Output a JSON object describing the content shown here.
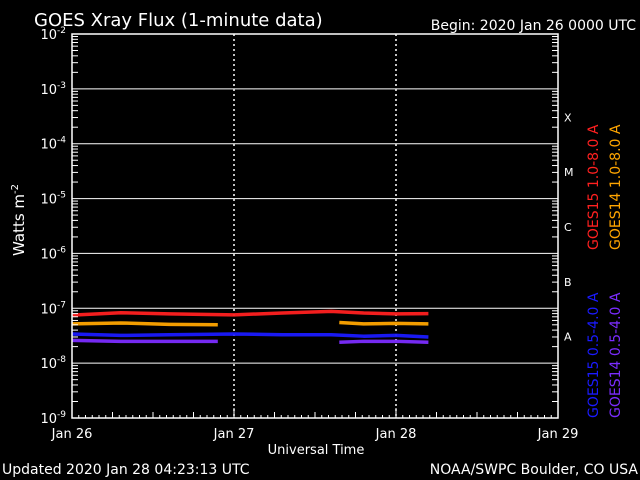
{
  "title": "GOES Xray Flux (1-minute data)",
  "begin": "Begin:  2020 Jan 26 0000 UTC",
  "updated": "Updated 2020 Jan 28 04:23:13 UTC",
  "credit": "NOAA/SWPC Boulder, CO USA",
  "colors": {
    "background": "#000000",
    "axes": "#ffffff",
    "goes15_long": "#ff2020",
    "goes14_long": "#ffa500",
    "goes15_short": "#1a1aff",
    "goes14_short": "#7b2cff"
  },
  "chart_data": {
    "type": "line",
    "title": "GOES Xray Flux (1-minute data)",
    "xlabel": "Universal Time",
    "ylabel": "Watts m-2",
    "yscale": "log",
    "ylim": [
      1e-09,
      0.01
    ],
    "xlim_days": [
      0,
      3
    ],
    "x_ticks": [
      "Jan 26",
      "Jan 27",
      "Jan 28",
      "Jan 29"
    ],
    "y_ticks": [
      {
        "base": "10",
        "exp": "-9",
        "value": 1e-09
      },
      {
        "base": "10",
        "exp": "-8",
        "value": 1e-08
      },
      {
        "base": "10",
        "exp": "-7",
        "value": 1e-07
      },
      {
        "base": "10",
        "exp": "-6",
        "value": 1e-06
      },
      {
        "base": "10",
        "exp": "-5",
        "value": 1e-05
      },
      {
        "base": "10",
        "exp": "-4",
        "value": 0.0001
      },
      {
        "base": "10",
        "exp": "-3",
        "value": 0.001
      },
      {
        "base": "10",
        "exp": "-2",
        "value": 0.01
      }
    ],
    "flare_classes": [
      {
        "label": "A",
        "value": 3.162e-08
      },
      {
        "label": "B",
        "value": 3.162e-07
      },
      {
        "label": "C",
        "value": 3.162e-06
      },
      {
        "label": "M",
        "value": 3.162e-05
      },
      {
        "label": "X",
        "value": 0.0003162
      }
    ],
    "grid": true,
    "series": [
      {
        "name": "GOES15 1.0-8.0 A",
        "color": "#ff2020",
        "x": [
          0.0,
          0.3,
          0.6,
          1.0,
          1.3,
          1.6,
          1.8,
          2.0,
          2.2
        ],
        "y": [
          7.5e-08,
          8.3e-08,
          7.9e-08,
          7.6e-08,
          8.2e-08,
          8.8e-08,
          8.2e-08,
          7.9e-08,
          8e-08
        ]
      },
      {
        "name": "GOES14 1.0-8.0 A",
        "color": "#ffa500",
        "segments": [
          {
            "x": [
              0.0,
              0.3,
              0.6,
              0.9
            ],
            "y": [
              5.2e-08,
              5.4e-08,
              5.1e-08,
              5e-08
            ]
          },
          {
            "x": [
              1.65,
              1.8,
              2.0,
              2.2
            ],
            "y": [
              5.5e-08,
              5.2e-08,
              5.3e-08,
              5.2e-08
            ]
          }
        ]
      },
      {
        "name": "GOES15 0.5-4.0 A",
        "color": "#1a1aff",
        "x": [
          0.0,
          0.3,
          0.6,
          1.0,
          1.3,
          1.6,
          1.8,
          2.0,
          2.2
        ],
        "y": [
          3.4e-08,
          3.2e-08,
          3.3e-08,
          3.4e-08,
          3.3e-08,
          3.3e-08,
          3.1e-08,
          3.2e-08,
          3e-08
        ]
      },
      {
        "name": "GOES14 0.5-4.0 A",
        "color": "#7b2cff",
        "segments": [
          {
            "x": [
              0.0,
              0.3,
              0.6,
              0.9
            ],
            "y": [
              2.6e-08,
              2.5e-08,
              2.5e-08,
              2.5e-08
            ]
          },
          {
            "x": [
              1.65,
              1.8,
              2.0,
              2.2
            ],
            "y": [
              2.4e-08,
              2.5e-08,
              2.5e-08,
              2.4e-08
            ]
          }
        ]
      }
    ]
  }
}
